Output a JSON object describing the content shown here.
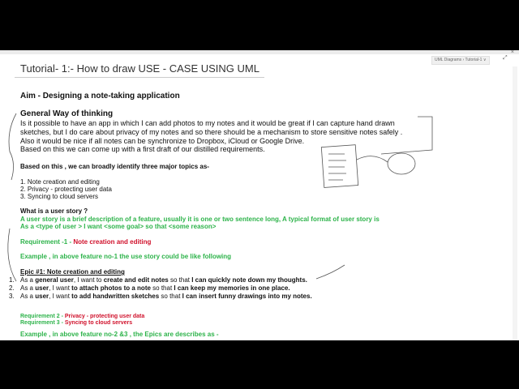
{
  "window": {
    "close": "×",
    "breadcrumb": "UML Diagrams › Tutorial-1 ∨",
    "expand": "⤢"
  },
  "title": "Tutorial- 1:- How to draw USE - CASE USING UML",
  "aim": "Aim - Designing a note-taking application",
  "general_heading": "General Way of thinking",
  "general_lines": [
    "Is it possible to have an app in which I can add photos to my notes and it would be great if I can capture hand drawn",
    "sketches, but I do care about privacy of my notes and so there should be a mechanism to store sensitive notes safely .",
    "Also it would be nice if all notes can be synchronize to Dropbox, iCloud or Google Drive.",
    "Based on this we can come up with a first draft of our distilled requirements."
  ],
  "topics_intro": "Based on this , we can broadly identify three major topics as-",
  "topics": [
    "1. Note creation and editing",
    "2. Privacy - protecting user data",
    "3. Syncing to cloud servers"
  ],
  "user_story_heading": "What is a user story ?",
  "user_story_lines": [
    "A user story is a brief description of a feature, usually it is one or two sentence long, A typical format of user story is",
    "As a <type of user > I want <some goal> so that <some reason>"
  ],
  "req1": {
    "label": "Requirement -1 - ",
    "value": "Note creation and editing"
  },
  "example1": "Example , in above feature no-1 the use story could be like following",
  "epic1": "Epic #1: Note creation and editing",
  "stories": [
    {
      "num": "1.",
      "a": "As a ",
      "b": "general user",
      "c": ", I want to ",
      "d": "create and edit notes",
      "e": " so that ",
      "f": "I can quickly note down my thoughts."
    },
    {
      "num": "2.",
      "a": "As a ",
      "b": "user",
      "c": ", I want ",
      "d": "to attach photos to a note",
      "e": " so that ",
      "f": "I can keep my memories in one place."
    },
    {
      "num": "3.",
      "a": "As a ",
      "b": "user",
      "c": ", I want ",
      "d": "to add handwritten sketches",
      "e": " so that ",
      "f": "I can insert funny drawings into my notes."
    }
  ],
  "req2": {
    "label": "Requirement 2 - ",
    "value": "Privacy - protecting user data"
  },
  "req3": {
    "label": "Requirement 3 - ",
    "value": "Syncing to cloud servers"
  },
  "example2": "Example , in above feature no-2 &3 , the Epics are describes as -"
}
